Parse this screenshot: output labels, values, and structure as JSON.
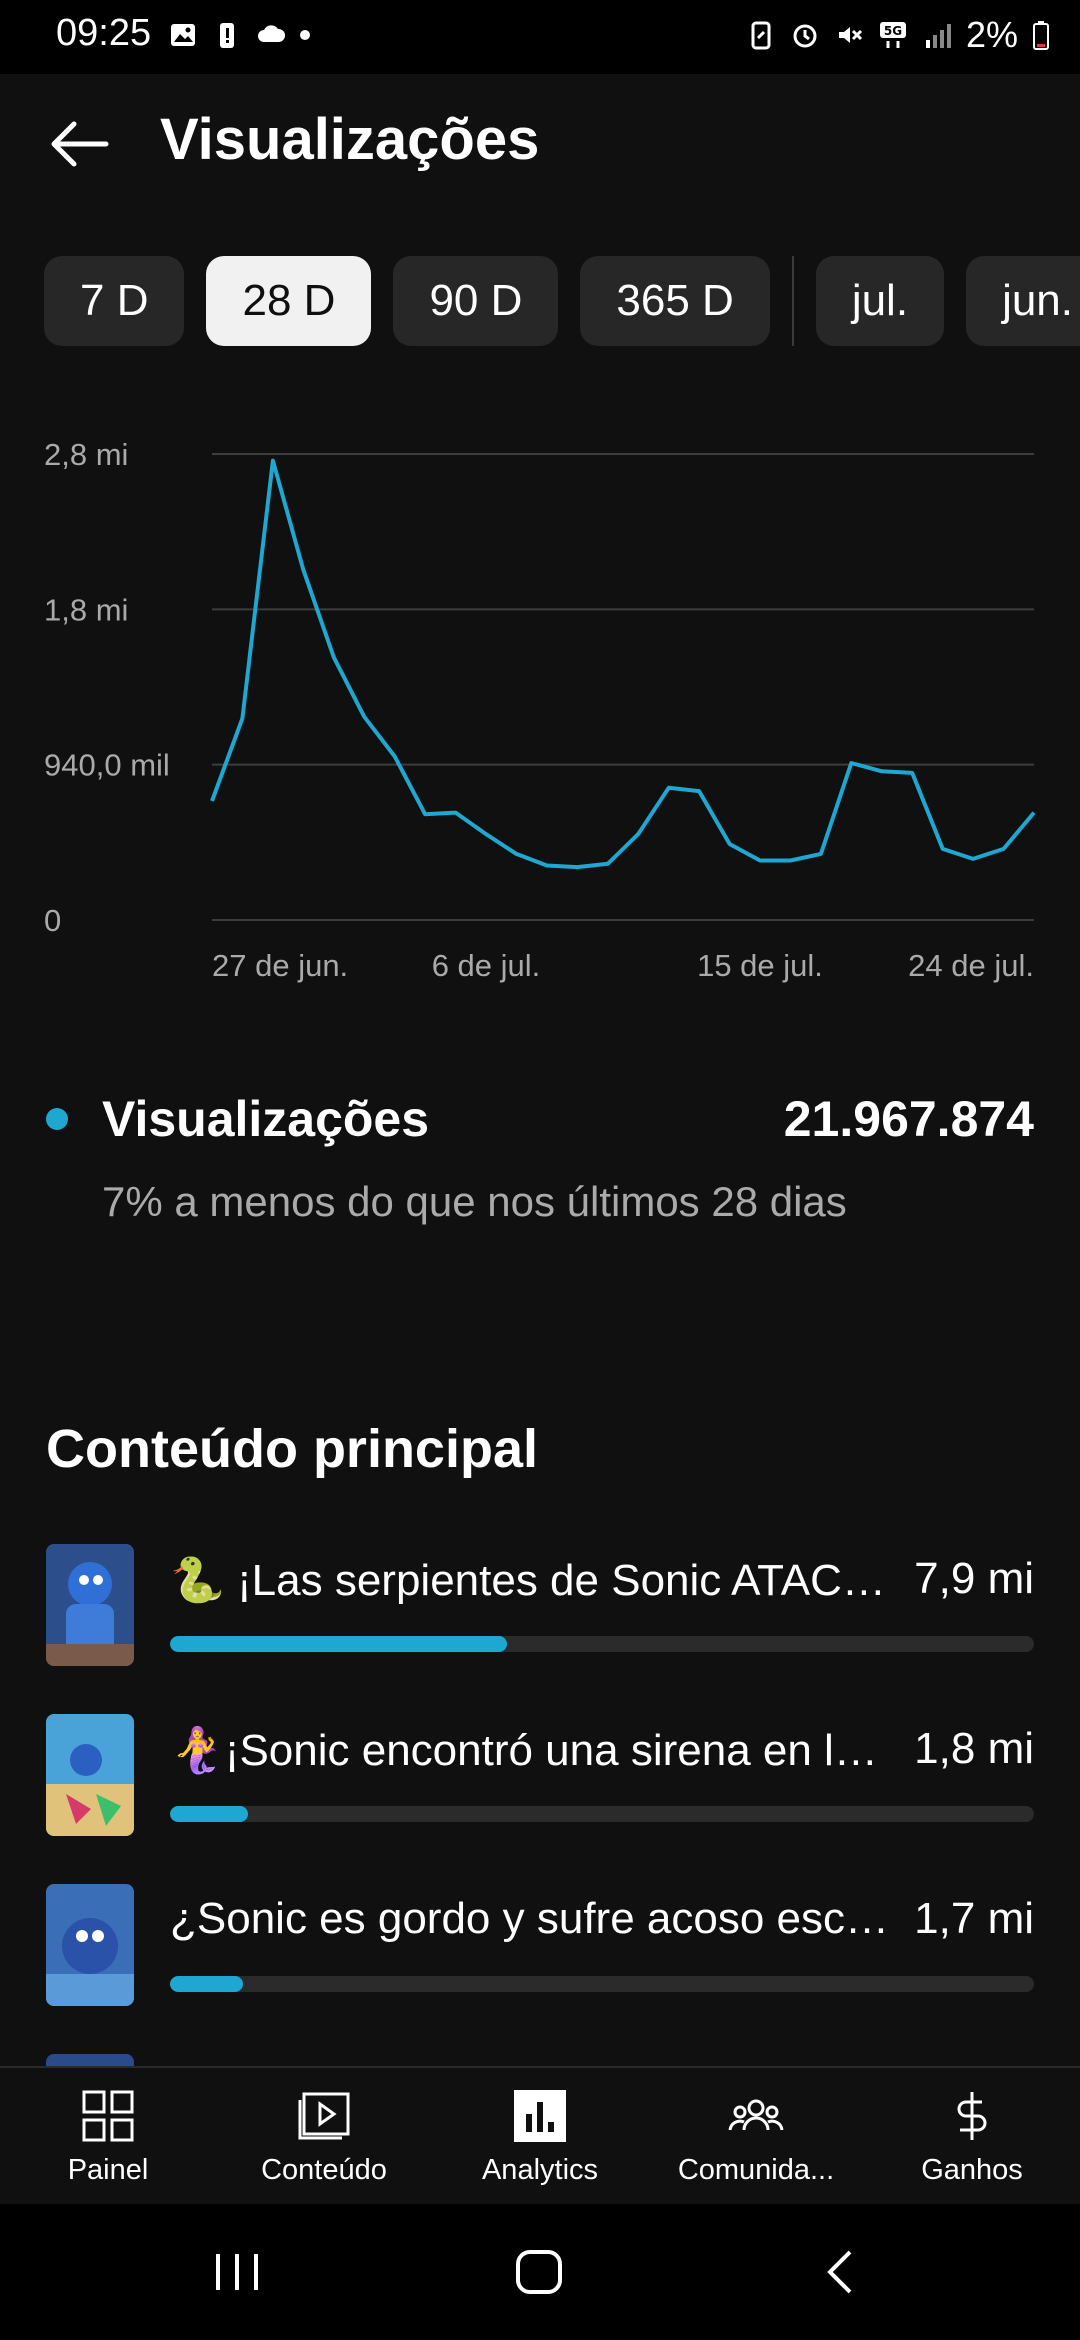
{
  "status_bar": {
    "time": "09:25",
    "battery": "2%",
    "network": "5G",
    "left_icons": [
      "image-icon",
      "battery-alert-icon",
      "cloud-icon",
      "dot-icon"
    ],
    "right_icons": [
      "battery-saver-icon",
      "alarm-icon",
      "mute-vibrate-icon",
      "5g-icon",
      "signal-icon"
    ]
  },
  "header": {
    "title": "Visualizações"
  },
  "periods": [
    {
      "label": "7 D",
      "active": false
    },
    {
      "label": "28 D",
      "active": true
    },
    {
      "label": "90 D",
      "active": false
    },
    {
      "label": "365 D",
      "active": false
    },
    {
      "label": "jul.",
      "active": false
    },
    {
      "label": "jun.",
      "active": false
    }
  ],
  "colors": {
    "accent": "#1ea7d1",
    "background": "#101010",
    "chip": "#272727",
    "chip_active": "#f1f1f1"
  },
  "chart_data": {
    "type": "line",
    "y_tick_labels": [
      "0",
      "940,0 mil",
      "1,8 mi",
      "2,8 mi"
    ],
    "y_tick_values": [
      0,
      940000,
      1880000,
      2820000
    ],
    "ylim": [
      0,
      2820000
    ],
    "x_tick_labels": [
      "27 de jun.",
      "6 de jul.",
      "15 de jul.",
      "24 de jul."
    ],
    "x_tick_indices": [
      2,
      9,
      18,
      25
    ],
    "grid": true,
    "series": [
      {
        "values": [
          720000,
          1220000,
          2780000,
          2120000,
          1590000,
          1230000,
          990000,
          640000,
          650000,
          520000,
          400000,
          330000,
          320000,
          340000,
          520000,
          800000,
          780000,
          460000,
          360000,
          360000,
          400000,
          950000,
          900000,
          890000,
          430000,
          370000,
          430000,
          650000
        ]
      }
    ]
  },
  "summary": {
    "label": "Visualizações",
    "value": "21.967.874",
    "comparison": "7% a menos do que nos últimos 28 dias"
  },
  "top_content": {
    "title": "Conteúdo principal",
    "items": [
      {
        "title": "🐍 ¡Las serpientes de Sonic ATACAN!",
        "views": "7,9 mi",
        "share": 0.39
      },
      {
        "title": "🧜‍♀️¡Sonic encontró una sirena en la playa!",
        "views": "1,8 mi",
        "share": 0.09
      },
      {
        "title": "¿Sonic es gordo y sufre acoso escolar?",
        "views": "1,7 mi",
        "share": 0.085
      }
    ]
  },
  "bottom_nav": [
    {
      "label": "Painel",
      "icon": "dashboard-icon"
    },
    {
      "label": "Conteúdo",
      "icon": "content-icon"
    },
    {
      "label": "Analytics",
      "icon": "analytics-icon"
    },
    {
      "label": "Comunida...",
      "icon": "community-icon"
    },
    {
      "label": "Ganhos",
      "icon": "dollar-icon"
    }
  ]
}
